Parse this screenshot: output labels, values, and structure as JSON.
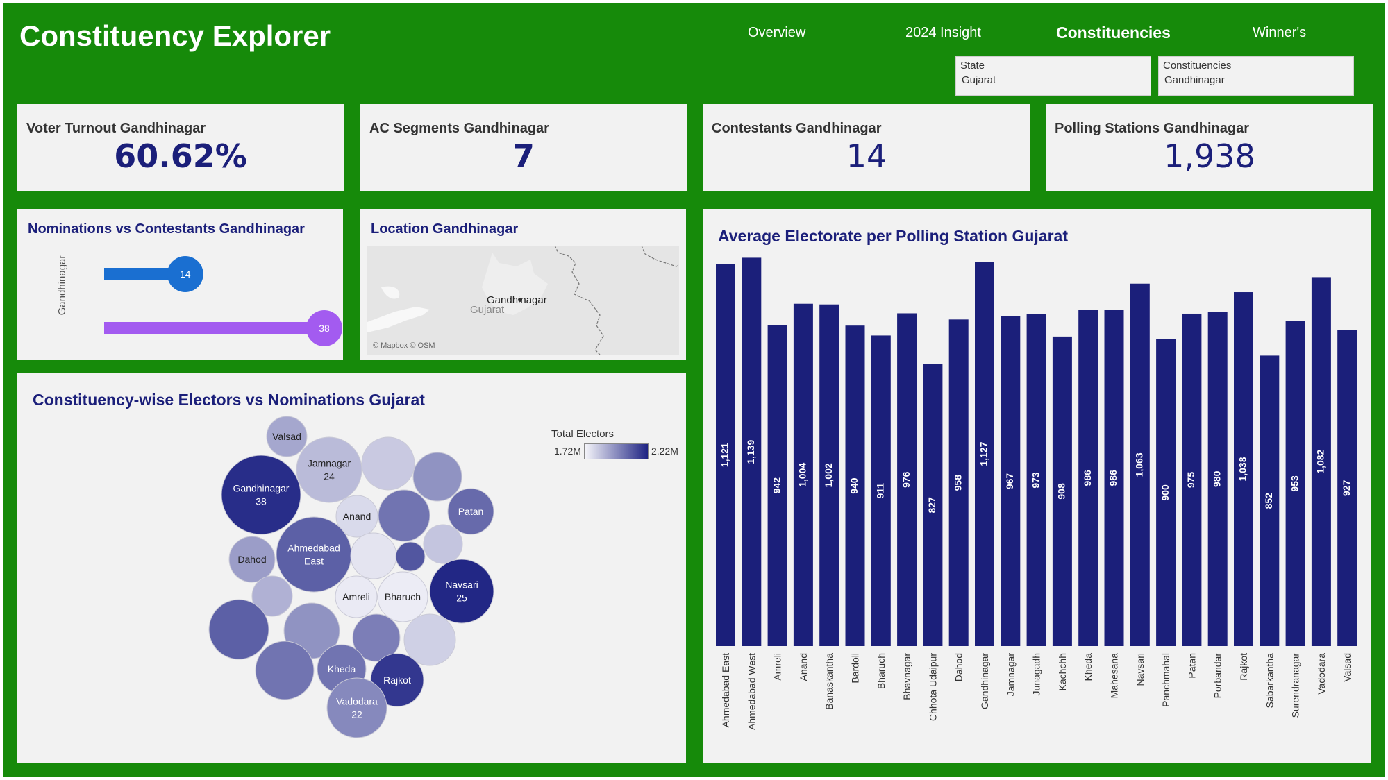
{
  "app": {
    "title": "Constituency Explorer"
  },
  "nav": [
    {
      "label": "Overview"
    },
    {
      "label": "2024 Insight"
    },
    {
      "label": "Constituencies"
    },
    {
      "label": "Winner's"
    }
  ],
  "filters": {
    "state": {
      "label": "State",
      "value": "Gujarat"
    },
    "constituency": {
      "label": "Constituencies",
      "value": "Gandhinagar"
    }
  },
  "kpis": [
    {
      "label": "Voter Turnout Gandhinagar",
      "value": "60.62%"
    },
    {
      "label": "AC Segments Gandhinagar",
      "value": "7"
    },
    {
      "label": "Contestants Gandhinagar",
      "value": "14"
    },
    {
      "label": "Polling Stations Gandhinagar",
      "value": "1,938"
    }
  ],
  "nominations": {
    "title": "Nominations vs Contestants Gandhinagar",
    "axis_label": "Gandhinagar",
    "contestants": 14,
    "nominations": 38,
    "contestants_label": "14",
    "nominations_label": "38",
    "max": 38,
    "colors": {
      "contestants": "#1a6fd1",
      "nominations": "#a35bf0"
    }
  },
  "map": {
    "title": "Location Gandhinagar",
    "city_label": "Gandhinagar",
    "state_label": "Gujarat",
    "attribution": "© Mapbox © OSM"
  },
  "bubble": {
    "title": "Constituency-wise Electors vs Nominations  Gujarat",
    "legend": {
      "title": "Total Electors",
      "min_label": "1.72M",
      "max_label": "2.22M"
    },
    "bubbles": [
      {
        "name": "Valsad",
        "value": "",
        "level": 0.35
      },
      {
        "name": "Jamnagar",
        "value": "24",
        "level": 0.25
      },
      {
        "name": "",
        "value": "",
        "level": 0.18
      },
      {
        "name": "",
        "value": "",
        "level": 0.45
      },
      {
        "name": "Gandhinagar",
        "value": "38",
        "level": 0.95
      },
      {
        "name": "Anand",
        "value": "",
        "level": 0.1
      },
      {
        "name": "",
        "value": "",
        "level": 0.6
      },
      {
        "name": "Patan",
        "value": "",
        "level": 0.65
      },
      {
        "name": "Dahod",
        "value": "",
        "level": 0.4
      },
      {
        "name": "Ahmedabad East",
        "value": "",
        "level": 0.7
      },
      {
        "name": "",
        "value": "",
        "level": 0.05
      },
      {
        "name": "",
        "value": "",
        "level": 0.75
      },
      {
        "name": "",
        "value": "",
        "level": 0.2
      },
      {
        "name": "Navsari",
        "value": "25",
        "level": 0.98
      },
      {
        "name": "",
        "value": "",
        "level": 0.3
      },
      {
        "name": "Amreli",
        "value": "",
        "level": 0.02
      },
      {
        "name": "Bharuch",
        "value": "",
        "level": 0.01
      },
      {
        "name": "",
        "value": "",
        "level": 0.7
      },
      {
        "name": "",
        "value": "",
        "level": 0.45
      },
      {
        "name": "",
        "value": "",
        "level": 0.55
      },
      {
        "name": "",
        "value": "",
        "level": 0.15
      },
      {
        "name": "",
        "value": "",
        "level": 0.6
      },
      {
        "name": "Kheda",
        "value": "",
        "level": 0.6
      },
      {
        "name": "Rajkot",
        "value": "",
        "level": 0.9
      },
      {
        "name": "Vadodara",
        "value": "22",
        "level": 0.5
      }
    ]
  },
  "chart_data": {
    "type": "bar",
    "title": "Average Electorate per Polling Station Gujarat",
    "categories": [
      "Ahmedabad East",
      "Ahmedabad West",
      "Amreli",
      "Anand",
      "Banaskantha",
      "Bardoli",
      "Bharuch",
      "Bhavnagar",
      "Chhota Udaipur",
      "Dahod",
      "Gandhinagar",
      "Jamnagar",
      "Junagadh",
      "Kachchh",
      "Kheda",
      "Mahesana",
      "Navsari",
      "Panchmahal",
      "Patan",
      "Porbandar",
      "Rajkot",
      "Sabarkantha",
      "Surendranagar",
      "Vadodara",
      "Valsad"
    ],
    "values": [
      1121,
      1139,
      942,
      1004,
      1002,
      940,
      911,
      976,
      827,
      958,
      1127,
      967,
      973,
      908,
      986,
      986,
      1063,
      900,
      975,
      980,
      1038,
      852,
      953,
      1082,
      927
    ],
    "labels": [
      "1,121",
      "1,139",
      "942",
      "1,004",
      "1,002",
      "940",
      "911",
      "976",
      "827",
      "958",
      "1,127",
      "967",
      "973",
      "908",
      "986",
      "986",
      "1,063",
      "900",
      "975",
      "980",
      "1,038",
      "852",
      "953",
      "1,082",
      "927"
    ],
    "ylim": [
      0,
      1150
    ],
    "color": "#1b1f7a",
    "grid": false
  }
}
